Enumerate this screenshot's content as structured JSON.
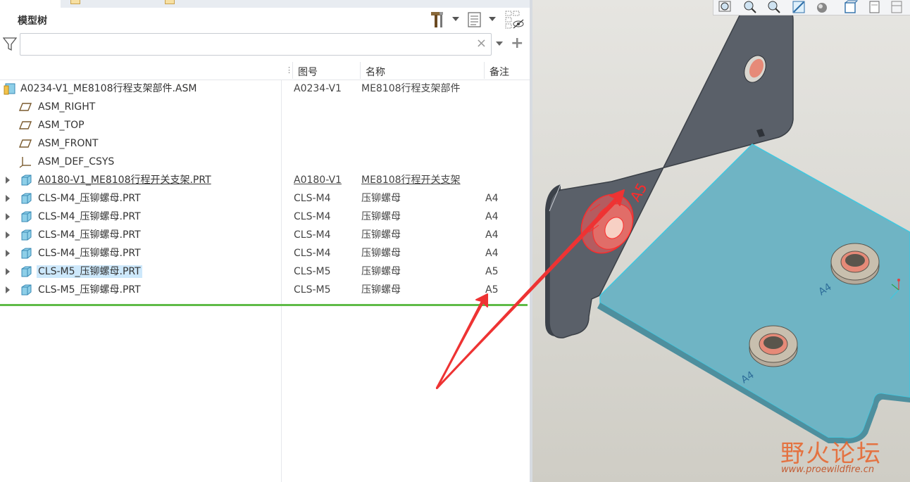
{
  "model_tree": {
    "title": "模型树",
    "search": {
      "value": "",
      "placeholder": ""
    },
    "clear_glyph": "×",
    "add_glyph": "+",
    "columns": {
      "drawing_no": "图号",
      "name": "名称",
      "remark": "备注"
    },
    "rows": [
      {
        "name": "A0234-V1_ME8108行程支架部件.ASM",
        "drawing_no": "A0234-V1",
        "part_name": "ME8108行程支架部件",
        "remark": "",
        "icon": "assembly-icon"
      },
      {
        "name": "ASM_RIGHT",
        "drawing_no": "",
        "part_name": "",
        "remark": "",
        "icon": "datum-plane-icon"
      },
      {
        "name": "ASM_TOP",
        "drawing_no": "",
        "part_name": "",
        "remark": "",
        "icon": "datum-plane-icon"
      },
      {
        "name": "ASM_FRONT",
        "drawing_no": "",
        "part_name": "",
        "remark": "",
        "icon": "datum-plane-icon"
      },
      {
        "name": "ASM_DEF_CSYS",
        "drawing_no": "",
        "part_name": "",
        "remark": "",
        "icon": "coordinate-system-icon"
      },
      {
        "name": "A0180-V1_ME8108行程开关支架.PRT",
        "drawing_no": "A0180-V1",
        "part_name": "ME8108行程开关支架",
        "remark": "",
        "icon": "part-icon"
      },
      {
        "name": "CLS-M4_压铆螺母.PRT",
        "drawing_no": "CLS-M4",
        "part_name": "压铆螺母",
        "remark": "A4",
        "icon": "part-icon"
      },
      {
        "name": "CLS-M4_压铆螺母.PRT",
        "drawing_no": "CLS-M4",
        "part_name": "压铆螺母",
        "remark": "A4",
        "icon": "part-icon"
      },
      {
        "name": "CLS-M4_压铆螺母.PRT",
        "drawing_no": "CLS-M4",
        "part_name": "压铆螺母",
        "remark": "A4",
        "icon": "part-icon"
      },
      {
        "name": "CLS-M4_压铆螺母.PRT",
        "drawing_no": "CLS-M4",
        "part_name": "压铆螺母",
        "remark": "A4",
        "icon": "part-icon"
      },
      {
        "name": "CLS-M5_压铆螺母.PRT",
        "drawing_no": "CLS-M5",
        "part_name": "压铆螺母",
        "remark": "A5",
        "icon": "part-icon",
        "selected": true
      },
      {
        "name": "CLS-M5_压铆螺母.PRT",
        "drawing_no": "CLS-M5",
        "part_name": "压铆螺母",
        "remark": "A5",
        "icon": "part-icon"
      }
    ]
  },
  "viewport": {
    "annotations": {
      "selected_nut": "A5",
      "nut_1": "A4",
      "nut_2": "A4"
    },
    "watermark": {
      "title": "野火论坛",
      "url": "www.proewildfire.cn"
    }
  },
  "colors": {
    "selection": "#cde8fb",
    "insert_marker": "#5fbb47",
    "arrow": "#ee3333",
    "sheet_top": "#6fb4c4",
    "bracket_gray": "#5a6069"
  }
}
